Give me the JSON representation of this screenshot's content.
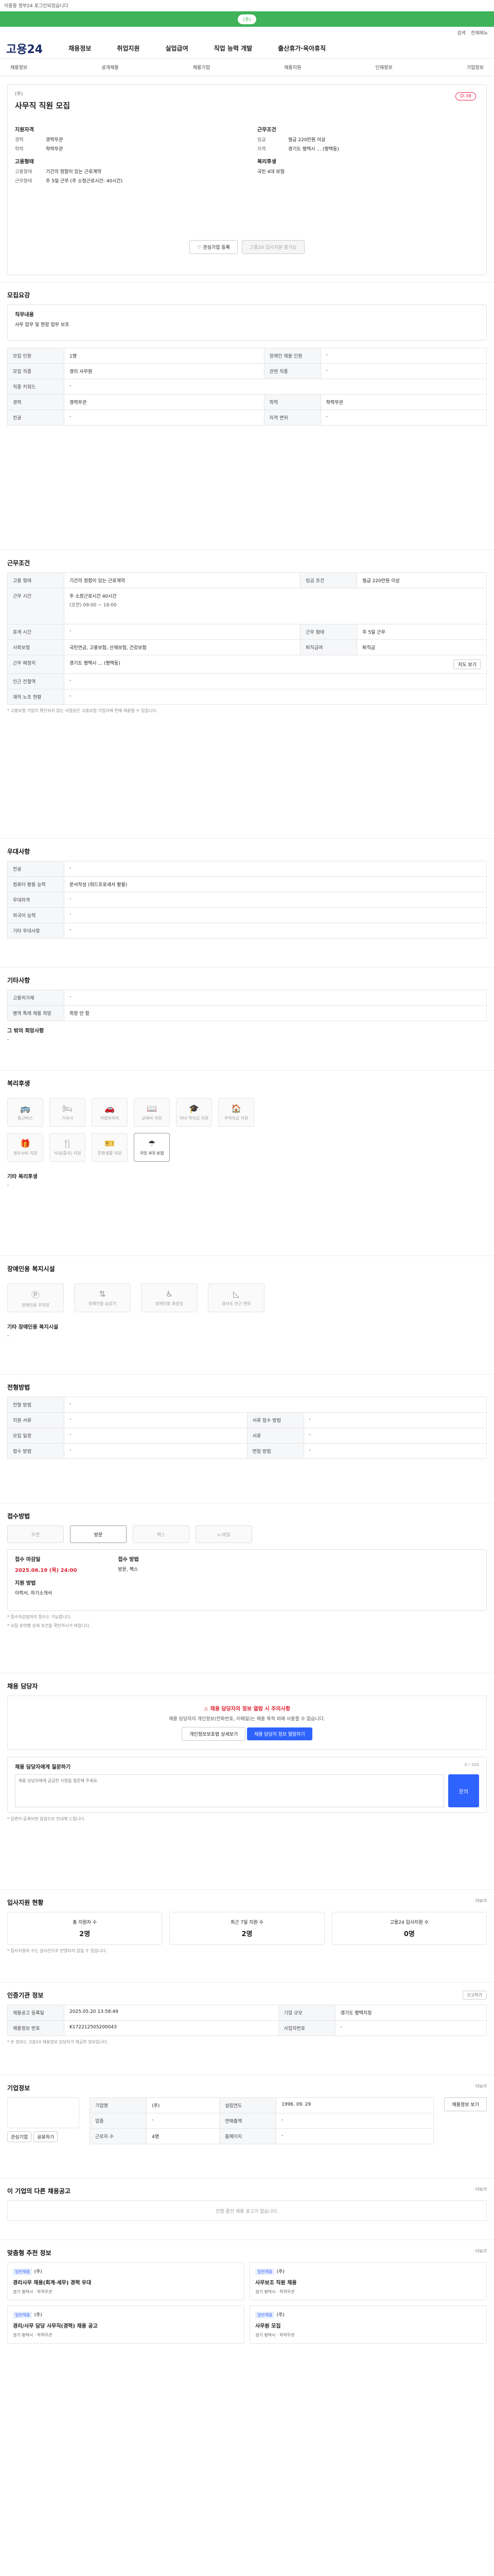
{
  "topbar": {
    "notice": "이용중 정부24 로그인되었습니다"
  },
  "greenbar": {
    "label": "(주)"
  },
  "search_row": {
    "search": "검색",
    "menu": "전체메뉴"
  },
  "header": {
    "logo": "고용24",
    "nav": [
      "채용정보",
      "취업지원",
      "실업급여",
      "직업 능력 개발",
      "출산휴가·육아휴직"
    ]
  },
  "subnav": [
    "채용정보",
    "공개채용",
    "채용기업",
    "채용지원",
    "인재정보",
    "기업정보"
  ],
  "job": {
    "company_label": "(주)",
    "title": "사무직 직원 모집",
    "dday": "D-38",
    "conditions_h": "지원자격",
    "conditions": [
      {
        "k": "경력",
        "v": "경력무관"
      },
      {
        "k": "학력",
        "v": "학력무관"
      }
    ],
    "work_h": "근무조건",
    "work": [
      {
        "k": "임금",
        "v": "월급 220만원 이상"
      },
      {
        "k": "지역",
        "v": "경기도 평택시 ... (평택동)"
      }
    ],
    "employ_h": "고용형태",
    "employ": [
      {
        "k": "고용형태",
        "v": "기간의 정함이 있는 근로계약"
      },
      {
        "k": "근무형태",
        "v": "주 5일 근무 (주 소정근로시간: 40시간)"
      }
    ],
    "welfare_h": "복리후생",
    "welfare": "국민 4대 보험",
    "btn_scrap": "관심기업 등록",
    "btn_apply": "고용24 입사지원 불가능"
  },
  "recruit": {
    "title": "모집요강",
    "desc_h": "직무내용",
    "desc": "사무 업무 및 현장 업무 보조",
    "rows": [
      [
        "모집 인원",
        "1명",
        "장애인 채용 인원",
        "-"
      ],
      [
        "모집 직종",
        "경리 사무원",
        "관련 직종",
        "-"
      ],
      [
        "직종 키워드",
        "-",
        "",
        ""
      ],
      [
        "경력",
        "경력무관",
        "학력",
        "학력무관"
      ],
      [
        "전공",
        "-",
        "자격 면허",
        "-"
      ]
    ]
  },
  "work_cond": {
    "title": "근무조건",
    "type_k": "고용 형태",
    "type_v": "기간의 정함이 있는 근로계약",
    "wage_k": "임금 조건",
    "wage_v": "월급 220만원 이상",
    "hour_k": "근무 시간",
    "hour_v": "주 소정근로시간 40시간",
    "hour_detail": "(오전) 09:00 ~ 18:00",
    "break_k": "휴게 시간",
    "break_v": "-",
    "style_k": "근무 형태",
    "style_v": "주 5일 근무",
    "social_k": "사회보험",
    "social_v": "국민연금, 고용보험, 산재보험, 건강보험",
    "retire_k": "퇴직급여",
    "retire_v": "퇴직금",
    "loc_k": "근무 예정지",
    "loc_v": "경기도 평택시 ... (평택동)",
    "loc_btn": "지도 보기",
    "near_k": "인근 전철역",
    "near_v": "-",
    "dorm_k": "재직 노조 현황",
    "dorm_v": "-",
    "note": "* 고용보험 가입이 확인되지 않는 사업장은 고용보험 가입자에 한해 채용될 수 있습니다."
  },
  "preference": {
    "title": "우대사항",
    "rows": [
      [
        "전공",
        "-"
      ],
      [
        "컴퓨터 활용 능력",
        "문서작성 (워드프로세서 활용)"
      ],
      [
        "우대자격",
        "-"
      ],
      [
        "외국어 능력",
        "-"
      ],
      [
        "기타 우대사항",
        "-"
      ]
    ]
  },
  "other": {
    "title": "기타사항",
    "rows": [
      [
        "고용허가제",
        "-"
      ],
      [
        "병역 특례 채용 희망",
        "희망 안 함"
      ]
    ],
    "extra_h": "그 밖의 희망사항",
    "extra_v": "-"
  },
  "welfare": {
    "title": "복리후생",
    "icons": [
      "통근버스",
      "기숙사",
      "차량유지비",
      "교육비 지원",
      "자녀 학자금 지원",
      "주택자금 지원",
      "경조사비 지원",
      "식대(중식) 지원",
      "문화생활 지원",
      "국민 4대 보험"
    ],
    "etc_h": "기타 복리후생",
    "etc_v": "-"
  },
  "disabled": {
    "title": "장애인용 복지시설",
    "icons": [
      "장애인용 주차장",
      "장애인용 승강기",
      "장애인용 화장실",
      "경사로 전근 편의"
    ],
    "etc_h": "기타 장애인용 복지시설",
    "etc_v": "-"
  },
  "apply_dates": {
    "title": "전형방법",
    "rows": [
      [
        "전형 방법",
        "-"
      ],
      [
        "지원 서류",
        "-",
        "서류 접수 방법",
        "-"
      ],
      [
        "모집 일정",
        "-",
        "서류",
        "-"
      ],
      [
        "접수 방법",
        "-",
        "면접 방법",
        "-"
      ]
    ]
  },
  "apply_method": {
    "title": "접수방법",
    "methods": [
      "우편",
      "방문",
      "팩스",
      "e-메일"
    ],
    "period_h": "접수 마감일",
    "period_v": "2025.06.19 (목) 24:00",
    "method_h": "접수 방법",
    "method_v": "방문, 팩스",
    "ask_h": "지원 방법",
    "ask_v": "이력서, 자기소개서",
    "notes": [
      "* 접수마감일까지 접수는 가능합니다.",
      "* 모집 분야별 상세 조건을 확인하시기 바랍니다."
    ]
  },
  "contact": {
    "title": "채용 담당자",
    "warn_title": "채용 담당자의 정보 열람 시 주의사항",
    "warn_text": "채용 담당자의 개인정보(전화번호, 이메일)는 채용 목적 외에 사용할 수 없습니다.",
    "btn_contact": "채용 담당자 정보 열람하기",
    "btn_report": "개인정보보호법 상세보기",
    "qa_h": "채용 담당자에게 질문하기",
    "qa_note": "0 / 300",
    "qa_placeholder": "채용 담당자에게 궁금한 사항을 질문해 주세요.",
    "qa_btn": "문의",
    "qa_foot": "* 답변이 등록되면 알림으로 안내해 드립니다."
  },
  "stats": {
    "title": "입사지원 현황",
    "link": "더보기",
    "items": [
      {
        "k": "총 지원자 수",
        "v": "2명"
      },
      {
        "k": "최근 7일 지원 수",
        "v": "2명"
      },
      {
        "k": "고용24 입사지원 수",
        "v": "0명"
      }
    ],
    "note": "* 입사지원자 수는 실시간으로 반영되지 않을 수 있습니다."
  },
  "job_info": {
    "title": "인증기관 정보",
    "btn": "신고하기",
    "rows": [
      [
        "채용공고 등록일",
        "2025.05.20 13:58:49",
        "기업 규모",
        "경기도 평택지청"
      ],
      [
        "채용정보 번호",
        "K172212505200043",
        "사업자번호",
        "-"
      ]
    ],
    "note": "* 본 정보는 고용24 채용정보 담당자가 제공한 정보입니다."
  },
  "company": {
    "title": "기업정보",
    "more": "더보기",
    "rows": [
      [
        "기업명",
        "(주)",
        "설립연도",
        "1996. 09. 29"
      ],
      [
        "업종",
        "-",
        "연매출액",
        "-"
      ],
      [
        "근로자 수",
        "4명",
        "홈페이지",
        "-"
      ]
    ],
    "btn1": "관심기업",
    "btn2": "공유하기",
    "btn3": "채용정보 보기"
  },
  "same_company": {
    "title": "이 기업의 다른 채용공고",
    "link": "더보기",
    "empty": "진행 중인 채용 공고가 없습니다."
  },
  "recommend": {
    "title": "맞춤형 추천 정보",
    "link": "더보기",
    "items": [
      {
        "badge": "일반채용",
        "company": "(주)",
        "title": "경리사무 채용(회계·세무) 경력 우대",
        "loc": "경기 평택시",
        "edu": "학력무관"
      },
      {
        "badge": "일반채용",
        "company": "(주)",
        "title": "사무보조 직원 채용",
        "loc": "경기 평택시",
        "edu": "학력무관"
      },
      {
        "badge": "일반채용",
        "company": "(주)",
        "title": "경리/사무 담당 사무직(경력) 채용 공고",
        "loc": "경기 평택시",
        "edu": "학력무관"
      },
      {
        "badge": "일반채용",
        "company": "(주)",
        "title": "사무원 모집",
        "loc": "경기 평택시",
        "edu": "학력무관"
      }
    ]
  }
}
